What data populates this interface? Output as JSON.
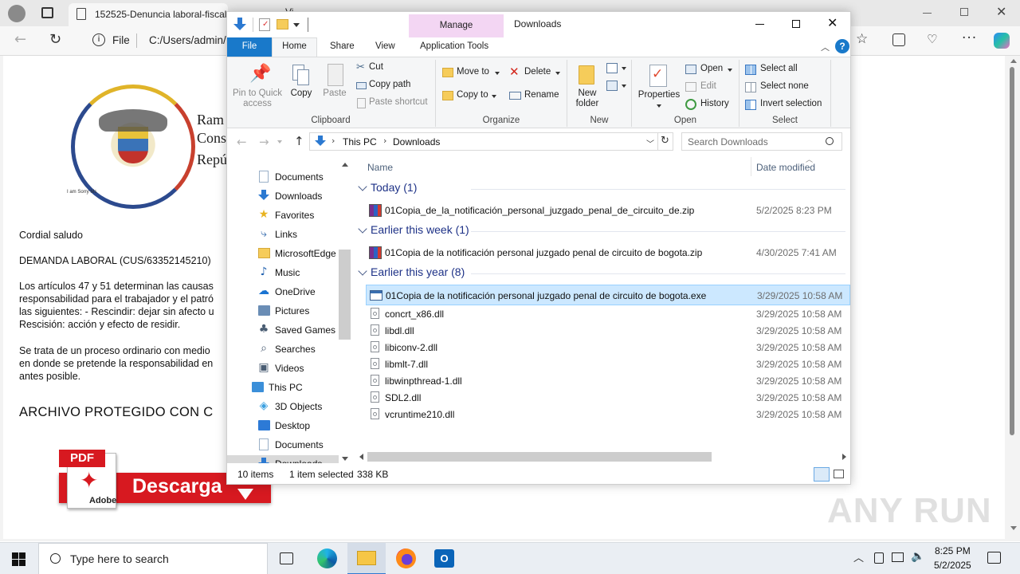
{
  "browser": {
    "tab_title": "152525-Denuncia laboral-fiscal",
    "second_tab_label": "Vi",
    "file_label": "File",
    "address": "C:/Users/admin/"
  },
  "document": {
    "seal_caption": "I am Sorry Ms",
    "header_lines": [
      "Ram",
      "Conse",
      "Repú"
    ],
    "greeting": "Cordial saludo",
    "subject": "DEMANDA LABORAL (CUS/63352145210)",
    "para1": [
      "Los artículos 47 y 51 determinan las causas",
      "responsabilidad para el trabajador y el patró",
      "las siguientes: - Rescindir: dejar sin afecto u",
      "Rescisión: acción y efecto de residir."
    ],
    "para2": [
      "Se trata de un proceso ordinario con medio",
      "en donde se pretende la responsabilidad en",
      "antes posible."
    ],
    "heading": "ARCHIVO PROTEGIDO CON C",
    "pdf_tag": "PDF",
    "adobe_tag": "Adobe",
    "download_button": "Descarga"
  },
  "explorer": {
    "title": "Downloads",
    "manage_label": "Manage",
    "ribbon_tabs": [
      "File",
      "Home",
      "Share",
      "View",
      "Application Tools"
    ],
    "clipboard": {
      "pin_lines": [
        "Pin to Quick",
        "access"
      ],
      "copy": "Copy",
      "paste": "Paste",
      "cut": "Cut",
      "copy_path": "Copy path",
      "paste_shortcut": "Paste shortcut",
      "group": "Clipboard"
    },
    "organize": {
      "move_to": "Move to",
      "delete": "Delete",
      "copy_to": "Copy to",
      "rename": "Rename",
      "group": "Organize"
    },
    "new": {
      "new_folder_lines": [
        "New",
        "folder"
      ],
      "group": "New"
    },
    "open": {
      "properties": "Properties",
      "open": "Open",
      "edit": "Edit",
      "history": "History",
      "group": "Open"
    },
    "select": {
      "select_all": "Select all",
      "select_none": "Select none",
      "invert": "Invert selection",
      "group": "Select"
    },
    "breadcrumb": [
      "This PC",
      "Downloads"
    ],
    "search_placeholder": "Search Downloads",
    "nav": [
      {
        "label": "Documents",
        "icon": "document-icon"
      },
      {
        "label": "Downloads",
        "icon": "download-arrow-icon"
      },
      {
        "label": "Favorites",
        "icon": "star-icon"
      },
      {
        "label": "Links",
        "icon": "link-icon"
      },
      {
        "label": "MicrosoftEdge",
        "icon": "folder-icon"
      },
      {
        "label": "Music",
        "icon": "music-icon"
      },
      {
        "label": "OneDrive",
        "icon": "cloud-icon"
      },
      {
        "label": "Pictures",
        "icon": "picture-icon"
      },
      {
        "label": "Saved Games",
        "icon": "game-icon"
      },
      {
        "label": "Searches",
        "icon": "search-icon"
      },
      {
        "label": "Videos",
        "icon": "video-icon"
      },
      {
        "label": "This PC",
        "icon": "computer-icon"
      },
      {
        "label": "3D Objects",
        "icon": "cube-icon"
      },
      {
        "label": "Desktop",
        "icon": "desktop-icon"
      },
      {
        "label": "Documents",
        "icon": "document-icon"
      },
      {
        "label": "Downloads",
        "icon": "download-arrow-icon"
      }
    ],
    "columns": {
      "name": "Name",
      "date": "Date modified"
    },
    "groups": [
      {
        "label": "Today (1)",
        "files": [
          {
            "name": "01Copia_de_la_notificación_personal_juzgado_penal_de_circuito_de.zip",
            "date": "5/2/2025 8:23 PM",
            "icon": "zip-archive-icon"
          }
        ]
      },
      {
        "label": "Earlier this week (1)",
        "files": [
          {
            "name": "01Copia de la notificación personal juzgado penal de circuito de bogota.zip",
            "date": "4/30/2025 7:41 AM",
            "icon": "zip-archive-icon"
          }
        ]
      },
      {
        "label": "Earlier this year (8)",
        "files": [
          {
            "name": "01Copia de la notificación personal juzgado penal de circuito de bogota.exe",
            "date": "3/29/2025 10:58 AM",
            "icon": "exe-icon",
            "selected": true
          },
          {
            "name": "concrt_x86.dll",
            "date": "3/29/2025 10:58 AM",
            "icon": "dll-icon"
          },
          {
            "name": "libdl.dll",
            "date": "3/29/2025 10:58 AM",
            "icon": "dll-icon"
          },
          {
            "name": "libiconv-2.dll",
            "date": "3/29/2025 10:58 AM",
            "icon": "dll-icon"
          },
          {
            "name": "libmlt-7.dll",
            "date": "3/29/2025 10:58 AM",
            "icon": "dll-icon"
          },
          {
            "name": "libwinpthread-1.dll",
            "date": "3/29/2025 10:58 AM",
            "icon": "dll-icon"
          },
          {
            "name": "SDL2.dll",
            "date": "3/29/2025 10:58 AM",
            "icon": "dll-icon"
          },
          {
            "name": "vcruntime210.dll",
            "date": "3/29/2025 10:58 AM",
            "icon": "dll-icon"
          }
        ]
      }
    ],
    "status": {
      "items": "10 items",
      "selected": "1 item selected",
      "size": "338 KB"
    }
  },
  "taskbar": {
    "search_placeholder": "Type here to search",
    "time": "8:25 PM",
    "date": "5/2/2025"
  },
  "watermark": "ANY RUN",
  "colors": {
    "accent": "#1979ca",
    "selection": "#cce8ff",
    "selection_border": "#99d1ff",
    "manage_tab": "#f3d6f3",
    "group_header": "#1e3287",
    "pdf_red": "#d71920"
  }
}
